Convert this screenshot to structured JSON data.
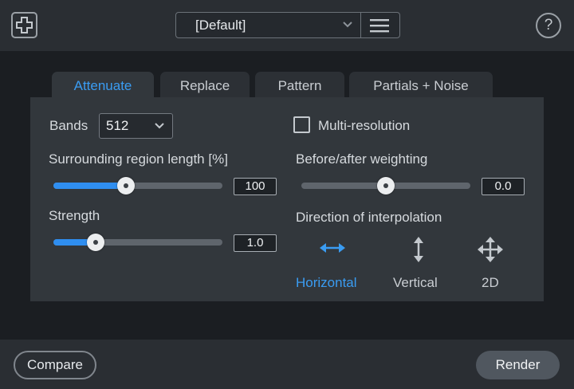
{
  "toolbar": {
    "preset_value": "[Default]",
    "help_label": "?"
  },
  "tabs": [
    {
      "label": "Attenuate",
      "active": true
    },
    {
      "label": "Replace",
      "active": false
    },
    {
      "label": "Pattern",
      "active": false
    },
    {
      "label": "Partials + Noise",
      "active": false
    }
  ],
  "attenuate": {
    "bands_label": "Bands",
    "bands_value": "512",
    "multires_label": "Multi-resolution",
    "multires_checked": false,
    "surrounding_label": "Surrounding region length [%]",
    "surrounding_value": "100",
    "surrounding_fraction": 0.43,
    "strength_label": "Strength",
    "strength_value": "1.0",
    "strength_fraction": 0.25,
    "weighting_label": "Before/after weighting",
    "weighting_value": "0.0",
    "weighting_fraction": 0.5,
    "direction_label": "Direction of interpolation",
    "directions": [
      {
        "label": "Horizontal",
        "icon": "horizontal-arrow-icon",
        "active": true
      },
      {
        "label": "Vertical",
        "icon": "vertical-arrow-icon",
        "active": false
      },
      {
        "label": "2D",
        "icon": "four-way-arrow-icon",
        "active": false
      }
    ]
  },
  "footer": {
    "compare_label": "Compare",
    "render_label": "Render"
  },
  "colors": {
    "accent": "#2f8ef0",
    "accent_text": "#3a9cf2",
    "panel": "#32373c",
    "background": "#1b1e22"
  }
}
